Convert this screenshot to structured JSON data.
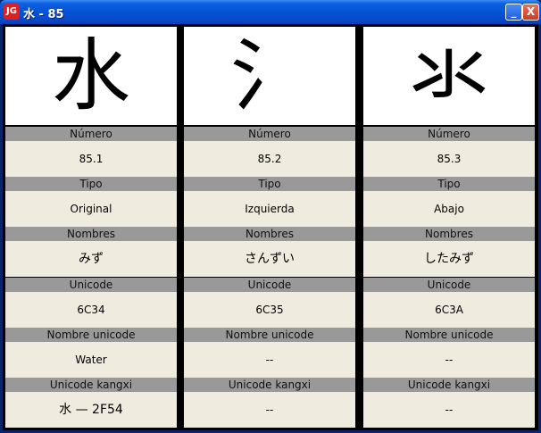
{
  "window": {
    "title": "水 - 85",
    "icon_name": "app-logo-icon",
    "minimize_symbol": "_",
    "close_symbol": "X"
  },
  "fields": {
    "numero": "Número",
    "tipo": "Tipo",
    "nombres": "Nombres",
    "unicode": "Unicode",
    "nombre_unicode": "Nombre unicode",
    "unicode_kangxi": "Unicode kangxi"
  },
  "columns": [
    {
      "char": "水",
      "numero": "85.1",
      "tipo": "Original",
      "nombres": "みず",
      "unicode": "6C34",
      "nombre_unicode": "Water",
      "unicode_kangxi": "水 — 2F54"
    },
    {
      "char": "氵",
      "numero": "85.2",
      "tipo": "Izquierda",
      "nombres": "さんずい",
      "unicode": "6C35",
      "nombre_unicode": "--",
      "unicode_kangxi": "--"
    },
    {
      "char": "氺",
      "numero": "85.3",
      "tipo": "Abajo",
      "nombres": "したみず",
      "unicode": "6C3A",
      "nombre_unicode": "--",
      "unicode_kangxi": "--"
    }
  ],
  "colors": {
    "band": "#999999",
    "value_bg": "#efecdf",
    "separator": "#000000",
    "titlebar": "#0654d6"
  }
}
